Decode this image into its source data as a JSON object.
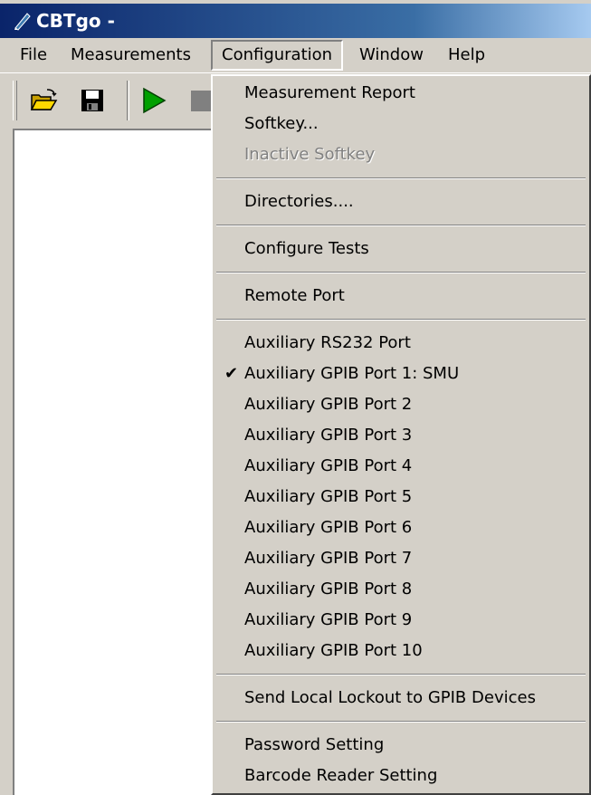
{
  "window": {
    "title": "CBTgo -"
  },
  "menubar": {
    "items": [
      {
        "label": "File"
      },
      {
        "label": "Measurements"
      },
      {
        "label": "Configuration"
      },
      {
        "label": "Window"
      },
      {
        "label": "Help"
      }
    ],
    "open_menu": "Configuration"
  },
  "toolbar": {
    "buttons": [
      {
        "icon": "open-folder-icon"
      },
      {
        "icon": "save-icon"
      },
      {
        "icon": "play-icon",
        "color": "#00a000"
      },
      {
        "icon": "stop-icon"
      }
    ]
  },
  "configuration_menu": {
    "items": [
      {
        "label": "Measurement Report"
      },
      {
        "label": "Softkey..."
      },
      {
        "label": "Inactive Softkey",
        "disabled": true
      },
      {
        "label": "Directories...."
      },
      {
        "label": "Configure Tests"
      },
      {
        "label": "Remote Port"
      },
      {
        "label": "Auxiliary RS232 Port"
      },
      {
        "label": "Auxiliary GPIB Port 1: SMU",
        "checked": true,
        "check_mark": "✔"
      },
      {
        "label": "Auxiliary GPIB Port 2"
      },
      {
        "label": "Auxiliary GPIB Port 3"
      },
      {
        "label": "Auxiliary GPIB Port 4"
      },
      {
        "label": "Auxiliary GPIB Port 5"
      },
      {
        "label": "Auxiliary GPIB Port 6"
      },
      {
        "label": "Auxiliary GPIB Port 7"
      },
      {
        "label": "Auxiliary GPIB Port 8"
      },
      {
        "label": "Auxiliary GPIB Port 9"
      },
      {
        "label": "Auxiliary GPIB Port 10"
      },
      {
        "label": "Send Local Lockout to GPIB Devices"
      },
      {
        "label": "Password Setting"
      },
      {
        "label": "Barcode Reader Setting"
      }
    ]
  },
  "colors": {
    "face": "#d4d0c8",
    "title_active": "#0a246a",
    "disabled_text": "#808080"
  }
}
